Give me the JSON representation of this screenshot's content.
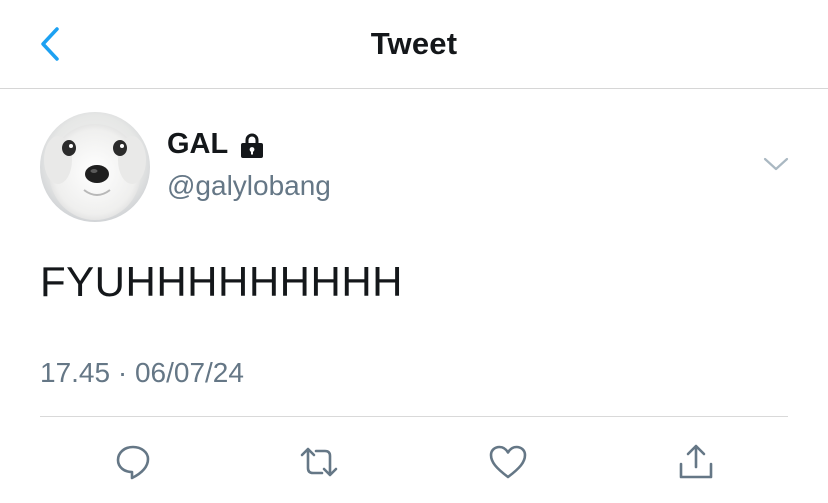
{
  "nav": {
    "title": "Tweet",
    "back_icon": "chevron-left-icon"
  },
  "tweet": {
    "author": {
      "display_name": "GAL",
      "handle": "@galylobang",
      "protected_icon": "lock-icon",
      "avatar": "dog-avatar"
    },
    "text": "FYUHHHHHHHHH",
    "timestamp": "17.45 · 06/07/24",
    "more_icon": "chevron-down-icon"
  },
  "actions": [
    {
      "icon": "reply-icon"
    },
    {
      "icon": "retweet-icon"
    },
    {
      "icon": "like-icon"
    },
    {
      "icon": "share-icon"
    }
  ],
  "colors": {
    "accent": "#1da1f2",
    "text": "#14171a",
    "secondary": "#657786",
    "icon": "#657786"
  }
}
